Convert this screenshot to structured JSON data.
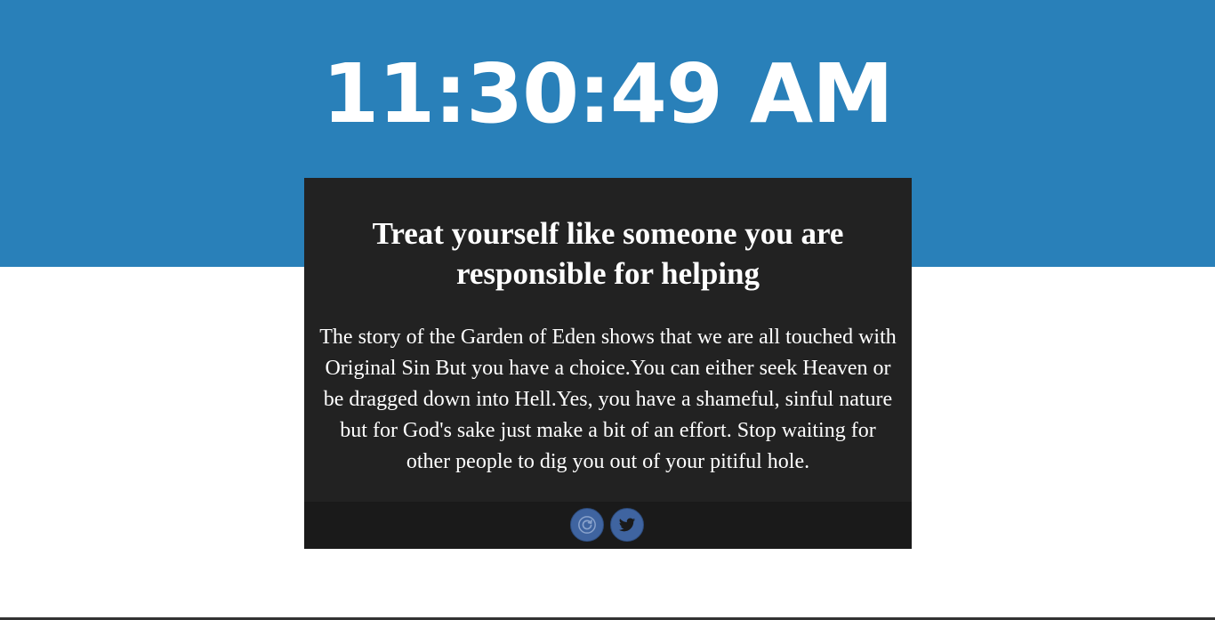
{
  "clock": {
    "time": "11:30:49 AM"
  },
  "quote": {
    "title": "Treat yourself like someone you are responsible for helping",
    "body": "The story of the Garden of Eden shows that we are all touched with Original Sin But you have a choice.You can either seek Heaven or be dragged down into Hell.Yes, you have a shameful, sinful nature but for God's sake just make a bit of an effort. Stop waiting for other people to dig you out of your pitiful hole."
  },
  "actions": {
    "refresh_icon": "refresh-icon",
    "twitter_icon": "twitter-icon"
  },
  "colors": {
    "band": "#2980b9",
    "card": "#222222",
    "footer": "#1a1a1a",
    "button": "#3f64a0"
  }
}
